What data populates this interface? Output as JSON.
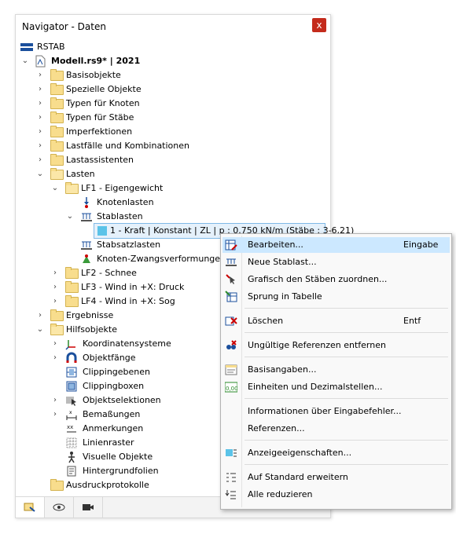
{
  "window": {
    "title": "Navigator - Daten",
    "close_label": "x"
  },
  "tree": {
    "root_label": "RSTAB",
    "model_label": "Modell.rs9* | 2021",
    "basisobjekte": "Basisobjekte",
    "spezielle": "Spezielle Objekte",
    "typen_knoten": "Typen für Knoten",
    "typen_staebe": "Typen für Stäbe",
    "imperfektionen": "Imperfektionen",
    "lastfaelle": "Lastfälle und Kombinationen",
    "lastassistenten": "Lastassistenten",
    "lasten": "Lasten",
    "lf1": "LF1 - Eigengewicht",
    "knotenlasten": "Knotenlasten",
    "stablasten": "Stablasten",
    "stablast_item": "1 - Kraft | Konstant | ZL | p : 0.750 kN/m (Stäbe : 3-6,21)",
    "stabsatzlasten": "Stabsatzlasten",
    "knoten_zwang": "Knoten-Zwangsverformungen",
    "lf2": "LF2 - Schnee",
    "lf3": "LF3 - Wind in +X: Druck",
    "lf4": "LF4 - Wind in +X: Sog",
    "ergebnisse": "Ergebnisse",
    "hilfsobjekte": "Hilfsobjekte",
    "koordinatensysteme": "Koordinatensysteme",
    "objektfaenge": "Objektfänge",
    "clippingebenen": "Clippingebenen",
    "clippingboxen": "Clippingboxen",
    "objektselektionen": "Objektselektionen",
    "bemassungen": "Bemaßungen",
    "anmerkungen": "Anmerkungen",
    "linienraster": "Linienraster",
    "visuelle": "Visuelle Objekte",
    "hintergrund": "Hintergrundfolien",
    "ausdruck": "Ausdruckprotokolle"
  },
  "context_menu": {
    "bearbeiten": "Bearbeiten...",
    "bearbeiten_key": "Eingabe",
    "neue_stablast": "Neue Stablast...",
    "grafisch": "Grafisch den Stäben zuordnen...",
    "sprung": "Sprung in Tabelle",
    "loeschen": "Löschen",
    "loeschen_key": "Entf",
    "ungueltige": "Ungültige Referenzen entfernen",
    "basisangaben": "Basisangaben...",
    "einheiten": "Einheiten und Dezimalstellen...",
    "informationen": "Informationen über Eingabefehler...",
    "referenzen": "Referenzen...",
    "anzeige": "Anzeigeeigenschaften...",
    "standard": "Auf Standard erweitern",
    "reduzieren": "Alle reduzieren"
  },
  "colors": {
    "accent": "#cce8ff",
    "close": "#c42b1c",
    "folder": "#f8dd8d"
  }
}
